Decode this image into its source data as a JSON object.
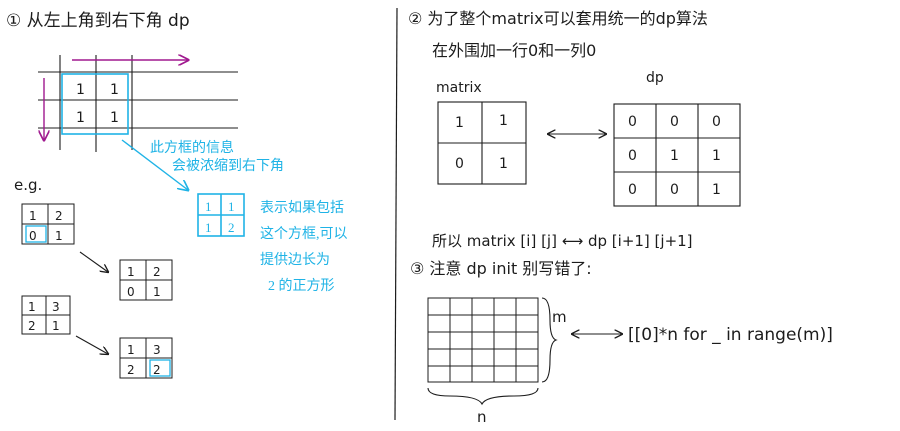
{
  "left": {
    "heading": "① 从左上角到右下角 dp",
    "grid_values": [
      "1",
      "1",
      "1",
      "1"
    ],
    "annotation_line1": "此方框的信息",
    "annotation_line2": "会被浓缩到右下角",
    "result_grid": [
      "1",
      "1",
      "1",
      "2"
    ],
    "result_note": [
      "表示如果包括",
      "这个方框,可以",
      "提供边长为",
      "2 的正方形"
    ],
    "eg_label": "e.g.",
    "ex1_before": [
      "1",
      "2",
      "0",
      "1"
    ],
    "ex1_after": [
      "1",
      "2",
      "0",
      "1"
    ],
    "ex2_before": [
      "1",
      "3",
      "2",
      "1"
    ],
    "ex2_after": [
      "1",
      "3",
      "2",
      "2"
    ]
  },
  "right": {
    "heading2_line1": "② 为了整个matrix可以套用统一的dp算法",
    "heading2_line2": "在外围加一行0和一列0",
    "matrix_label": "matrix",
    "matrix_values": [
      "1",
      "1",
      "0",
      "1"
    ],
    "dp_label": "dp",
    "dp_values": [
      "0",
      "0",
      "0",
      "0",
      "1",
      "1",
      "0",
      "0",
      "1"
    ],
    "mapping": "所以 matrix [i] [j] ⟷ dp [i+1] [j+1]",
    "heading3": "③ 注意 dp init 别写错了:",
    "m_label": "m",
    "n_label": "n",
    "init_code": "[[0]*n for _ in range(m)]"
  },
  "colors": {
    "ink": "#1c1c1c",
    "blue": "#1fb3e6",
    "purple": "#a0188f"
  }
}
